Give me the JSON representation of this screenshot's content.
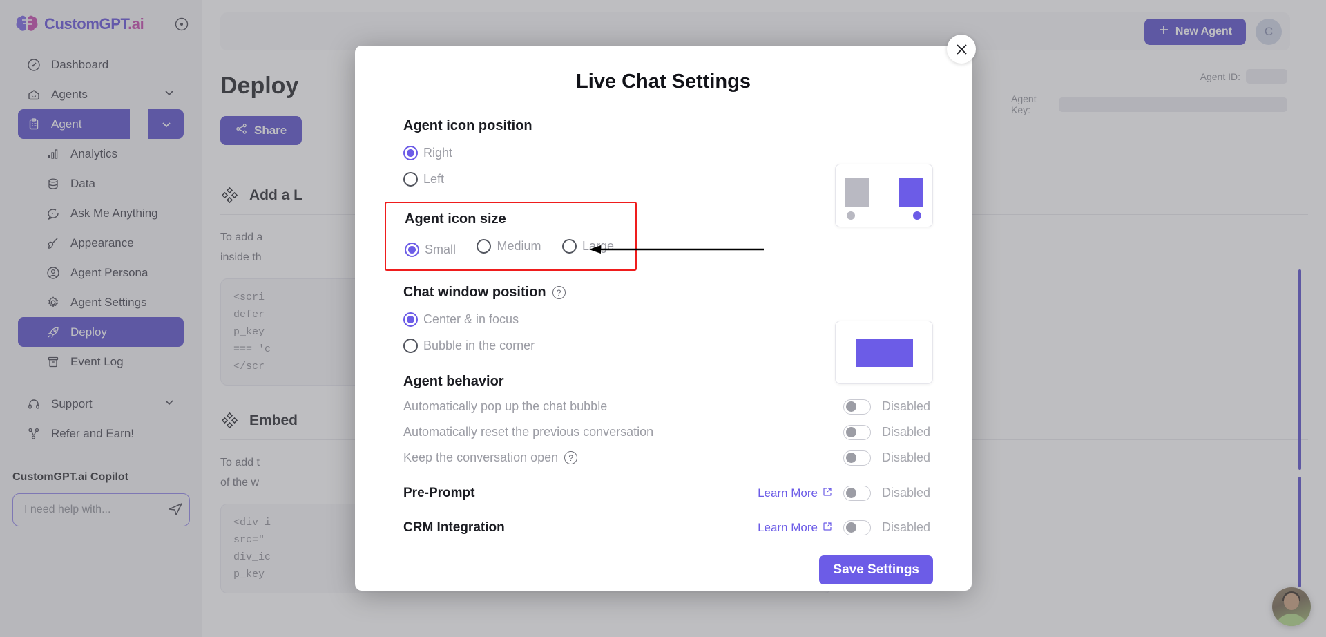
{
  "brand": {
    "name_a": "CustomGPT",
    "name_b": ".ai",
    "collapse_icon": "collapse-circle-icon"
  },
  "sidebar": {
    "items": [
      {
        "label": "Dashboard",
        "icon": "speedometer-icon",
        "type": "item"
      },
      {
        "label": "Agents",
        "icon": "home-icon",
        "type": "expandable"
      },
      {
        "label": "Agent",
        "icon": "clipboard-icon",
        "type": "expandable-active"
      },
      {
        "label": "Analytics",
        "icon": "bar-chart-icon",
        "type": "sub"
      },
      {
        "label": "Data",
        "icon": "database-icon",
        "type": "sub"
      },
      {
        "label": "Ask Me Anything",
        "icon": "chat-bubble-icon",
        "type": "sub"
      },
      {
        "label": "Appearance",
        "icon": "paintbrush-icon",
        "type": "sub"
      },
      {
        "label": "Agent Persona",
        "icon": "user-circle-icon",
        "type": "sub"
      },
      {
        "label": "Agent Settings",
        "icon": "gear-icon",
        "type": "sub"
      },
      {
        "label": "Deploy",
        "icon": "rocket-icon",
        "type": "sub-selected"
      },
      {
        "label": "Event Log",
        "icon": "archive-icon",
        "type": "sub"
      },
      {
        "label": "Support",
        "icon": "headset-icon",
        "type": "expandable"
      },
      {
        "label": "Refer and Earn!",
        "icon": "share-nodes-icon",
        "type": "item"
      }
    ]
  },
  "copilot": {
    "title": "CustomGPT.ai Copilot",
    "input_value": "",
    "placeholder": "I need help with...",
    "send_icon": "paper-plane-icon"
  },
  "topbar": {
    "new_agent_label": "New Agent",
    "new_agent_icon": "plus-icon",
    "avatar_initial": "C"
  },
  "page": {
    "title": "Deploy",
    "share_label": "Share",
    "share_icon": "share-icon",
    "agent_id_label": "Agent ID:",
    "agent_key_label": "Agent Key:"
  },
  "cards": [
    {
      "title": "Add a L",
      "icon": "diamonds-icon",
      "body_line1": "To add a",
      "body_line2": "inside th",
      "code": [
        "<scri",
        "defer",
        "p_key",
        "=== 'c",
        "</scr"
      ]
    },
    {
      "title": "Embed",
      "icon": "diamonds-icon",
      "body_line1": "To add t",
      "body_line2": "of the w",
      "code": [
        "<div i",
        "src=\"",
        "div_ic",
        "p_key"
      ]
    }
  ],
  "modal": {
    "title": "Live Chat Settings",
    "close_icon": "close-x-icon",
    "sections": {
      "icon_position": {
        "title": "Agent icon position",
        "options": [
          {
            "label": "Right",
            "selected": true
          },
          {
            "label": "Left",
            "selected": false
          }
        ]
      },
      "icon_size": {
        "title": "Agent icon size",
        "highlighted": true,
        "highlight_color": "#ef1d1d",
        "options": [
          {
            "label": "Small",
            "selected": true
          },
          {
            "label": "Medium",
            "selected": false
          },
          {
            "label": "Large",
            "selected": false
          }
        ]
      },
      "window_position": {
        "title": "Chat window position",
        "help_icon": "question-mark-icon",
        "options": [
          {
            "label": "Center & in focus",
            "selected": true
          },
          {
            "label": "Bubble in the corner",
            "selected": false
          }
        ]
      },
      "behavior": {
        "title": "Agent behavior",
        "rows": [
          {
            "label": "Automatically pop up the chat bubble",
            "state": "Disabled",
            "on": false,
            "help": false,
            "bold": false,
            "learn_more": null
          },
          {
            "label": "Automatically reset the previous conversation",
            "state": "Disabled",
            "on": false,
            "help": false,
            "bold": false,
            "learn_more": null
          },
          {
            "label": "Keep the conversation open",
            "state": "Disabled",
            "on": false,
            "help": true,
            "bold": false,
            "learn_more": null
          }
        ]
      },
      "features": {
        "rows": [
          {
            "label": "Pre-Prompt",
            "state": "Disabled",
            "on": false,
            "bold": true,
            "learn_more": "Learn More"
          },
          {
            "label": "CRM Integration",
            "state": "Disabled",
            "on": false,
            "bold": true,
            "learn_more": "Learn More"
          }
        ]
      }
    },
    "save_label": "Save Settings",
    "accent_color": "#6c5ce7"
  },
  "annotation": {
    "arrow_icon": "left-arrow-annotation",
    "color": "#000000"
  },
  "chat_fab": {
    "icon": "support-agent-avatar"
  }
}
